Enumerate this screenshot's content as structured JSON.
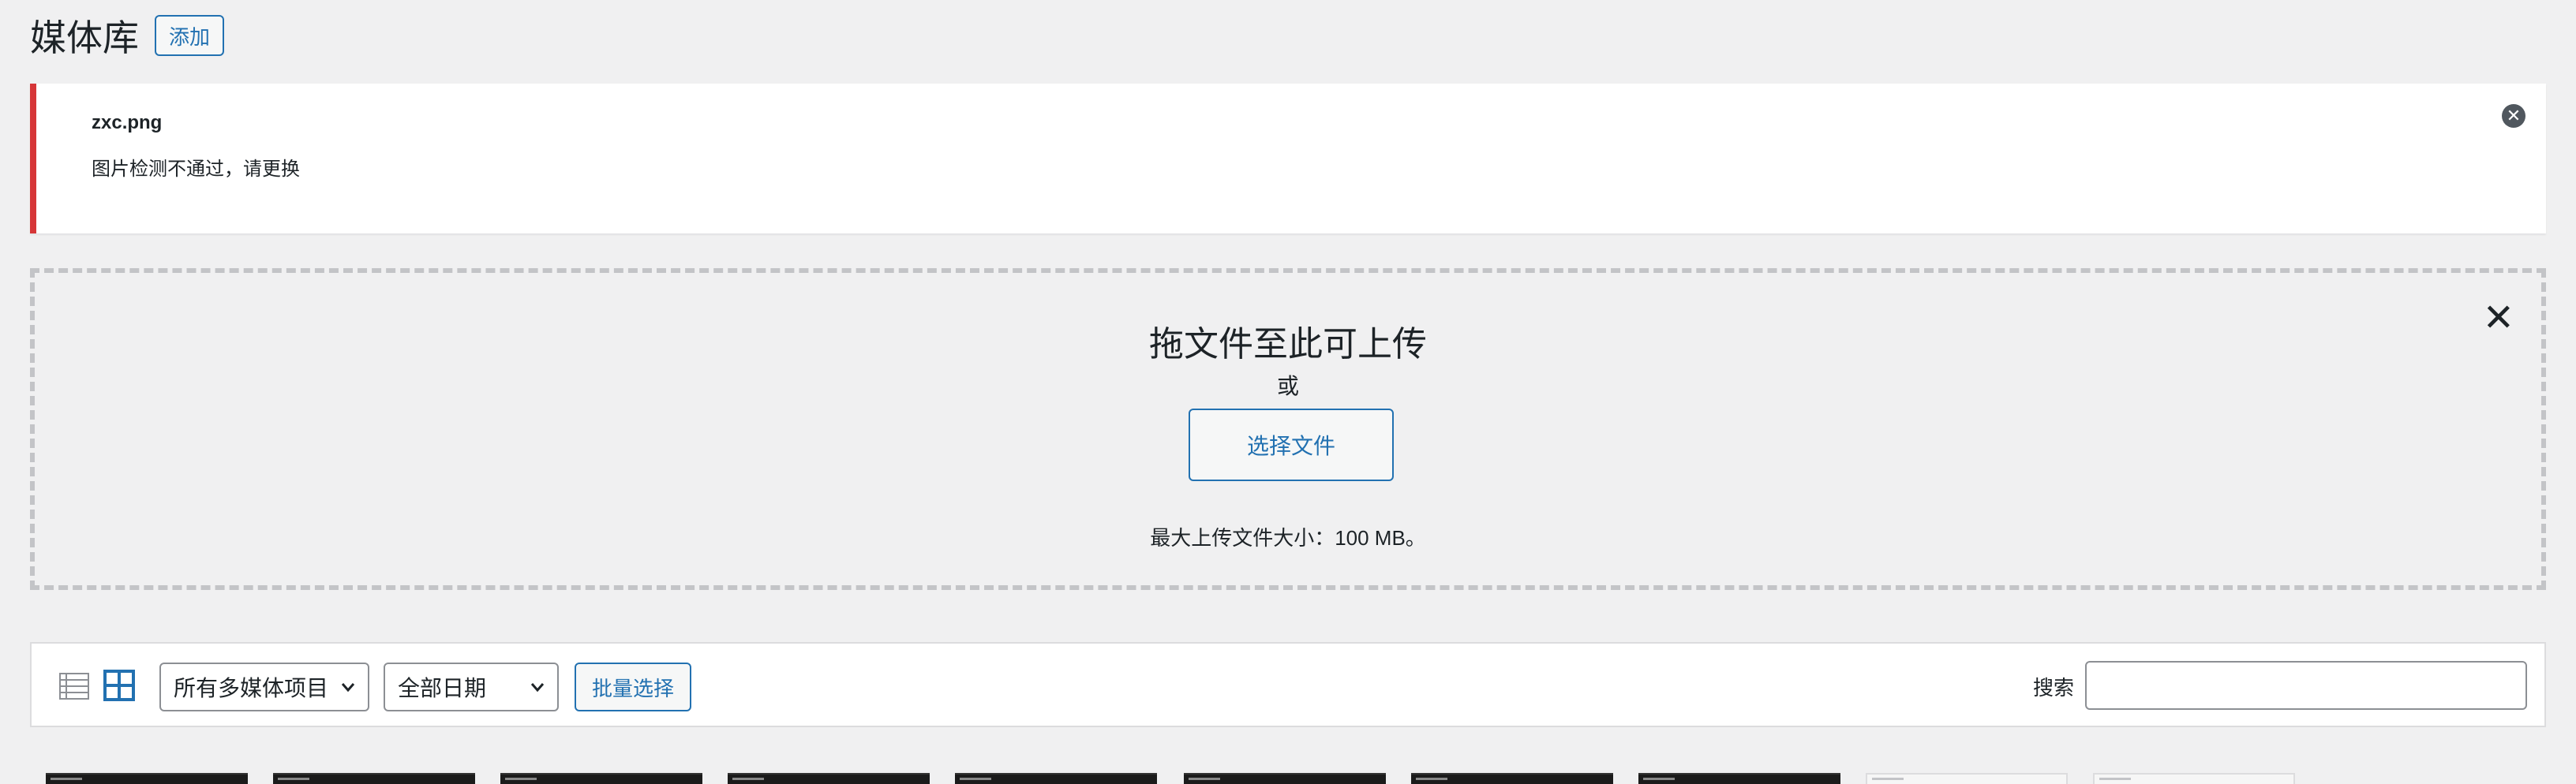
{
  "header": {
    "title": "媒体库",
    "add_button": "添加"
  },
  "notice": {
    "filename": "zxc.png",
    "message": "图片检测不通过，请更换",
    "dismiss_glyph": "✕",
    "accent_color": "#d63638"
  },
  "uploader": {
    "drop_title": "拖文件至此可上传",
    "or_text": "或",
    "select_files_button": "选择文件",
    "max_size": "最大上传文件大小：100 MB。",
    "close_glyph": "✕"
  },
  "toolbar": {
    "view_list_icon": "list-view-icon",
    "view_grid_icon": "grid-view-icon",
    "media_type_select": "所有多媒体项目",
    "date_select": "全部日期",
    "bulk_select_button": "批量选择",
    "search_label": "搜索",
    "search_value": ""
  },
  "thumbnails": [
    {
      "style": "dark"
    },
    {
      "style": "dark"
    },
    {
      "style": "dark"
    },
    {
      "style": "dark"
    },
    {
      "style": "dark"
    },
    {
      "style": "dark"
    },
    {
      "style": "dark"
    },
    {
      "style": "dark"
    },
    {
      "style": "light"
    },
    {
      "style": "light"
    }
  ],
  "colors": {
    "accent": "#2271b1",
    "background": "#f0f0f1",
    "error": "#d63638"
  }
}
